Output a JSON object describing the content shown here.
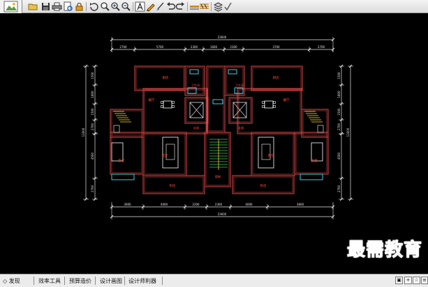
{
  "toolbar": {
    "buttons": [
      "open-folder-icon",
      "save-icon",
      "print-icon",
      "print-preview-icon",
      "lock-icon",
      "undo-special-icon",
      "zoom-window-icon",
      "zoom-in-icon",
      "zoom-out-icon",
      "text-icon",
      "pencil-icon",
      "brush-icon",
      "undo-icon",
      "redo-icon",
      "layer-line-icon",
      "hatch-icon",
      "layers-icon",
      "check-icon"
    ]
  },
  "statusbar": {
    "first_item": "发现",
    "tools": [
      "效率工具",
      "预算造价",
      "设计画图",
      "设计师利器"
    ]
  },
  "watermark": "最需教育",
  "drawing": {
    "dims": {
      "top_total": "23600",
      "top_segments": [
        "2700",
        "5700",
        "2300",
        "1600",
        "2300",
        "3700",
        "2700"
      ],
      "bottom_segments": [
        "3600",
        "4000",
        "2200",
        "2300",
        "4000",
        "3600"
      ],
      "bottom_total": "23600",
      "left_top_segments": [
        "1500",
        "1800",
        "1500",
        "2700"
      ],
      "left_total": "13000",
      "left_bottom_segments": [
        "4500",
        "2700"
      ],
      "right_top_segments": [
        "1500",
        "1800",
        "1500",
        "2700"
      ],
      "right_total": "13000",
      "right_bottom_segments": [
        "4500",
        "2700"
      ]
    },
    "rooms": {
      "kitchen": "厨房",
      "bath": "卫生间",
      "dining": "餐厅",
      "hall": "客厅",
      "bedroom": "卧室",
      "balcony": "阳台",
      "corridor": "走道",
      "stair": "楼梯"
    },
    "colors": {
      "wall": "#e04848",
      "dim": "#e8e8e8",
      "room_label": "#ff4a3a",
      "cyan": "#3ee7ff",
      "green": "#30d060",
      "yellow": "#ffd42a"
    }
  }
}
